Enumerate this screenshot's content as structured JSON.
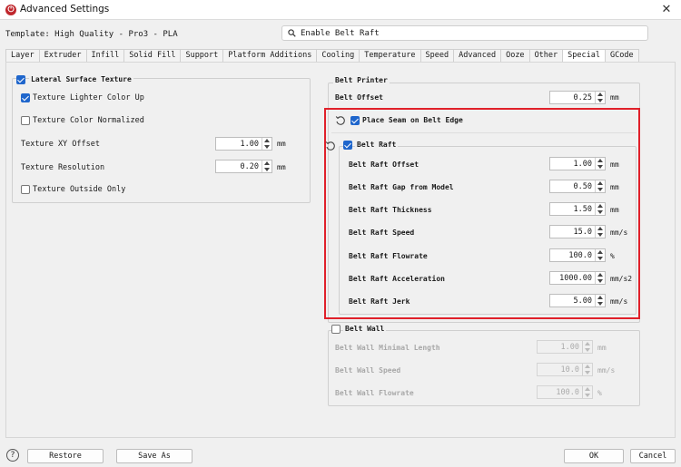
{
  "window": {
    "title": "Advanced Settings",
    "close_glyph": "✕"
  },
  "template": {
    "text": "Template: High Quality - Pro3 - PLA"
  },
  "search": {
    "value": "Enable Belt Raft"
  },
  "tabs": [
    "Layer",
    "Extruder",
    "Infill",
    "Solid Fill",
    "Support",
    "Platform Additions",
    "Cooling",
    "Temperature",
    "Speed",
    "Advanced",
    "Ooze",
    "Other",
    "Special",
    "GCode"
  ],
  "active_tab": "Special",
  "lateral": {
    "header": "Lateral Surface Texture",
    "lighter_label": "Texture Lighter Color Up",
    "normalized_label": "Texture Color Normalized",
    "xy_offset_label": "Texture XY Offset",
    "xy_offset_value": "1.00",
    "xy_offset_unit": "mm",
    "resolution_label": "Texture Resolution",
    "resolution_value": "0.20",
    "resolution_unit": "mm",
    "outside_only_label": "Texture Outside Only"
  },
  "belt_printer": {
    "header": "Belt Printer",
    "offset_label": "Belt Offset",
    "offset_value": "0.25",
    "offset_unit": "mm",
    "place_seam_label": "Place Seam on Belt Edge"
  },
  "belt_raft": {
    "header": "Belt Raft",
    "rows": [
      {
        "label": "Belt Raft Offset",
        "value": "1.00",
        "unit": "mm"
      },
      {
        "label": "Belt Raft Gap from Model",
        "value": "0.50",
        "unit": "mm"
      },
      {
        "label": "Belt Raft Thickness",
        "value": "1.50",
        "unit": "mm"
      },
      {
        "label": "Belt Raft Speed",
        "value": "15.0",
        "unit": "mm/s"
      },
      {
        "label": "Belt Raft Flowrate",
        "value": "100.0",
        "unit": "%"
      },
      {
        "label": "Belt Raft Acceleration",
        "value": "1000.00",
        "unit": "mm/s2"
      },
      {
        "label": "Belt Raft Jerk",
        "value": "5.00",
        "unit": "mm/s"
      }
    ]
  },
  "belt_wall": {
    "header": "Belt Wall",
    "rows": [
      {
        "label": "Belt Wall Minimal Length",
        "value": "1.00",
        "unit": "mm"
      },
      {
        "label": "Belt Wall Speed",
        "value": "10.0",
        "unit": "mm/s"
      },
      {
        "label": "Belt Wall Flowrate",
        "value": "100.0",
        "unit": "%"
      }
    ]
  },
  "buttons": {
    "help": "?",
    "restore": "Restore",
    "save_as": "Save As",
    "ok": "OK",
    "cancel": "Cancel"
  },
  "colors": {
    "accent": "#1f66cc",
    "highlight": "#e0202a",
    "brand": "#c0272d"
  }
}
